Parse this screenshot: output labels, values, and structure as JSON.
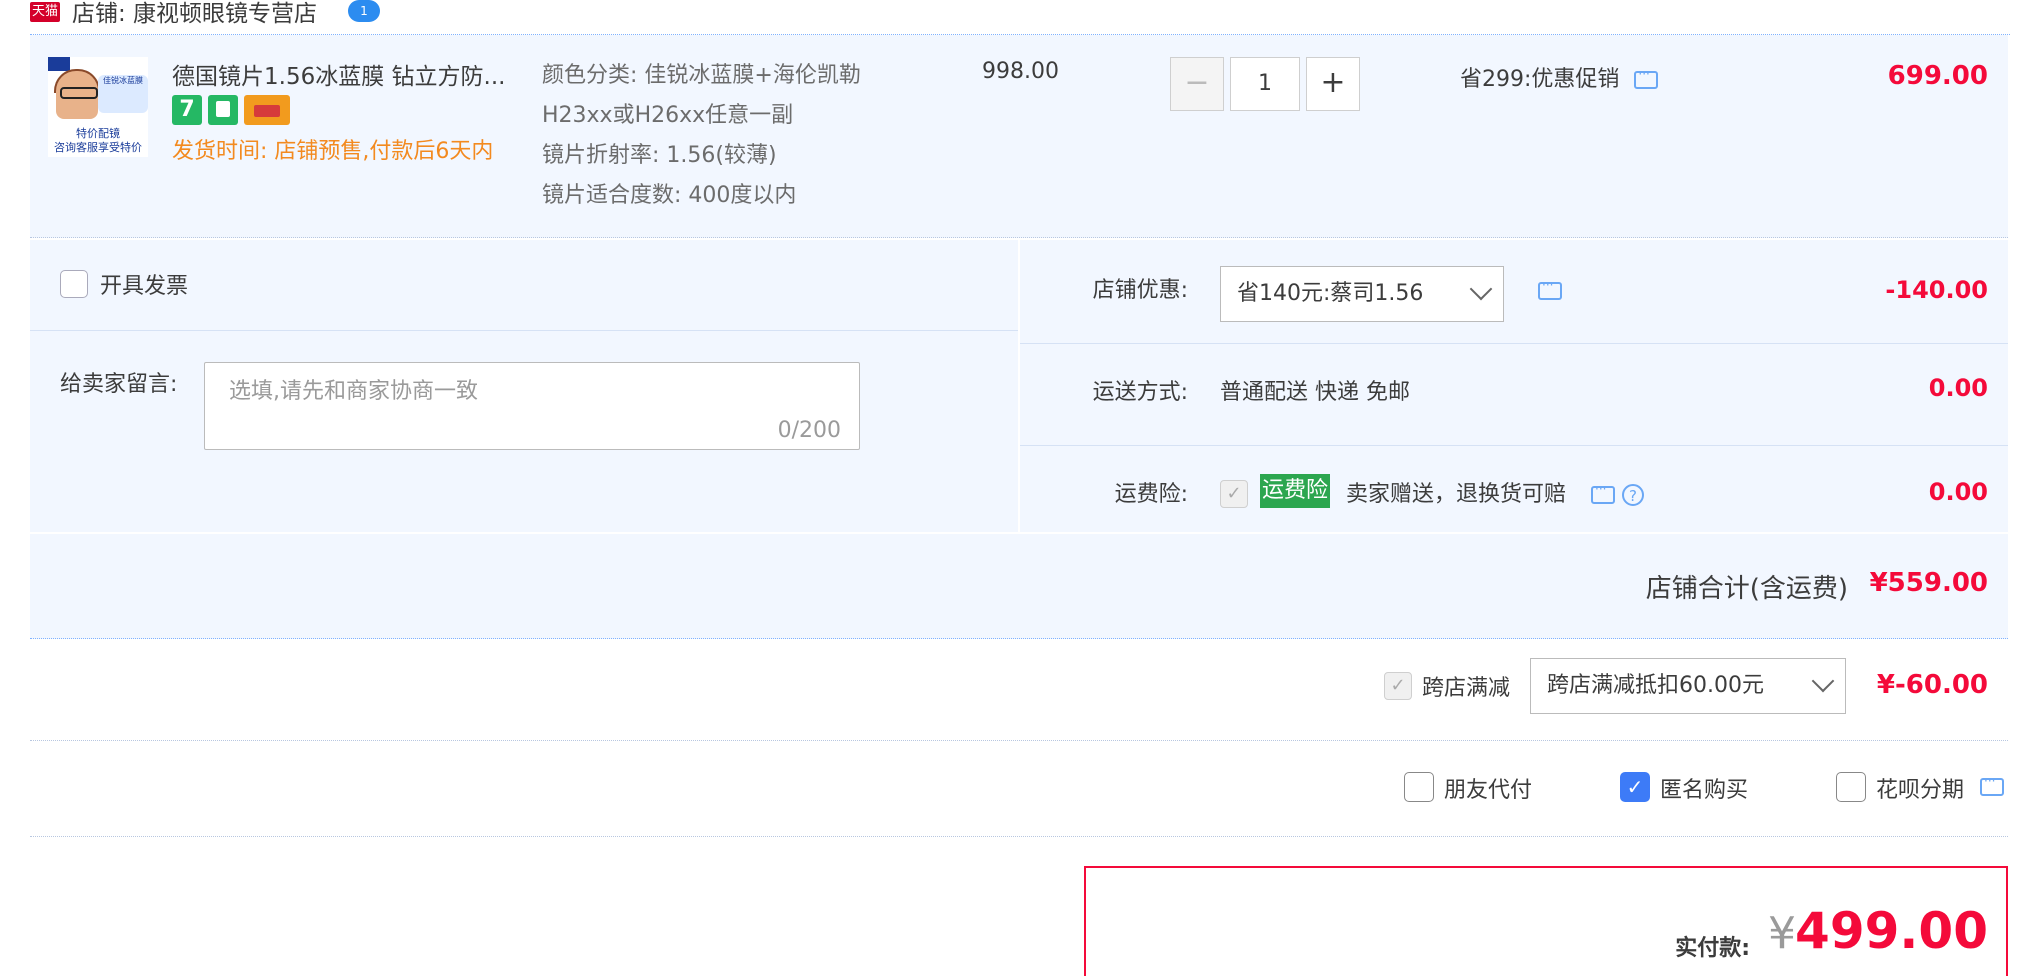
{
  "shop": {
    "platform_badge": "天猫",
    "name": "店铺: 康视顿眼镜专营店",
    "chat_badge": "1"
  },
  "item": {
    "thumb_caption_1": "特价配镜",
    "thumb_caption_2": "咨询客服享受特价",
    "thumb_tag": "佳锐冰蓝膜",
    "title": "德国镜片1.56冰蓝膜 钻立方防...",
    "service_icon_1": "7",
    "ship_time": "发货时间: 店铺预售,付款后6天内",
    "specs": [
      "颜色分类: 佳锐冰蓝膜+海伦凯勒",
      "H23xx或H26xx任意一副",
      "镜片折射率: 1.56(较薄)",
      "镜片适合度数: 400度以内"
    ],
    "unit_price": "998.00",
    "quantity": "1",
    "qty_minus": "−",
    "qty_plus": "+",
    "promo": "省299:优惠促销",
    "total": "699.00"
  },
  "invoice": {
    "label": "开具发票"
  },
  "message": {
    "label": "给卖家留言:",
    "placeholder": "选填,请先和商家协商一致",
    "counter": "0/200"
  },
  "discount": {
    "label": "店铺优惠:",
    "selected": "省140元:蔡司1.56",
    "amount": "-140.00"
  },
  "shipping": {
    "label": "运送方式:",
    "value": "普通配送 快递 免邮",
    "amount": "0.00"
  },
  "insurance": {
    "label": "运费险:",
    "tag": "运费险",
    "text": "卖家赠送，退换货可赔",
    "amount": "0.00"
  },
  "shop_total": {
    "label": "店铺合计(含运费)",
    "value": "¥559.00"
  },
  "cross_store": {
    "label": "跨店满减",
    "selected": "跨店满减抵扣60.00元",
    "amount": "¥-60.00"
  },
  "options": {
    "friend_pay": "朋友代付",
    "anonymous": "匿名购买",
    "huabei": "花呗分期"
  },
  "payment": {
    "label": "实付款:",
    "currency": "¥",
    "value": "499.00"
  },
  "colors": {
    "accent_red": "#f40a3a",
    "panel_bg": "#f2f7ff",
    "link_blue": "#3d7bf7",
    "ship_orange": "#f38a1f",
    "insurance_green": "#2ca64f"
  }
}
